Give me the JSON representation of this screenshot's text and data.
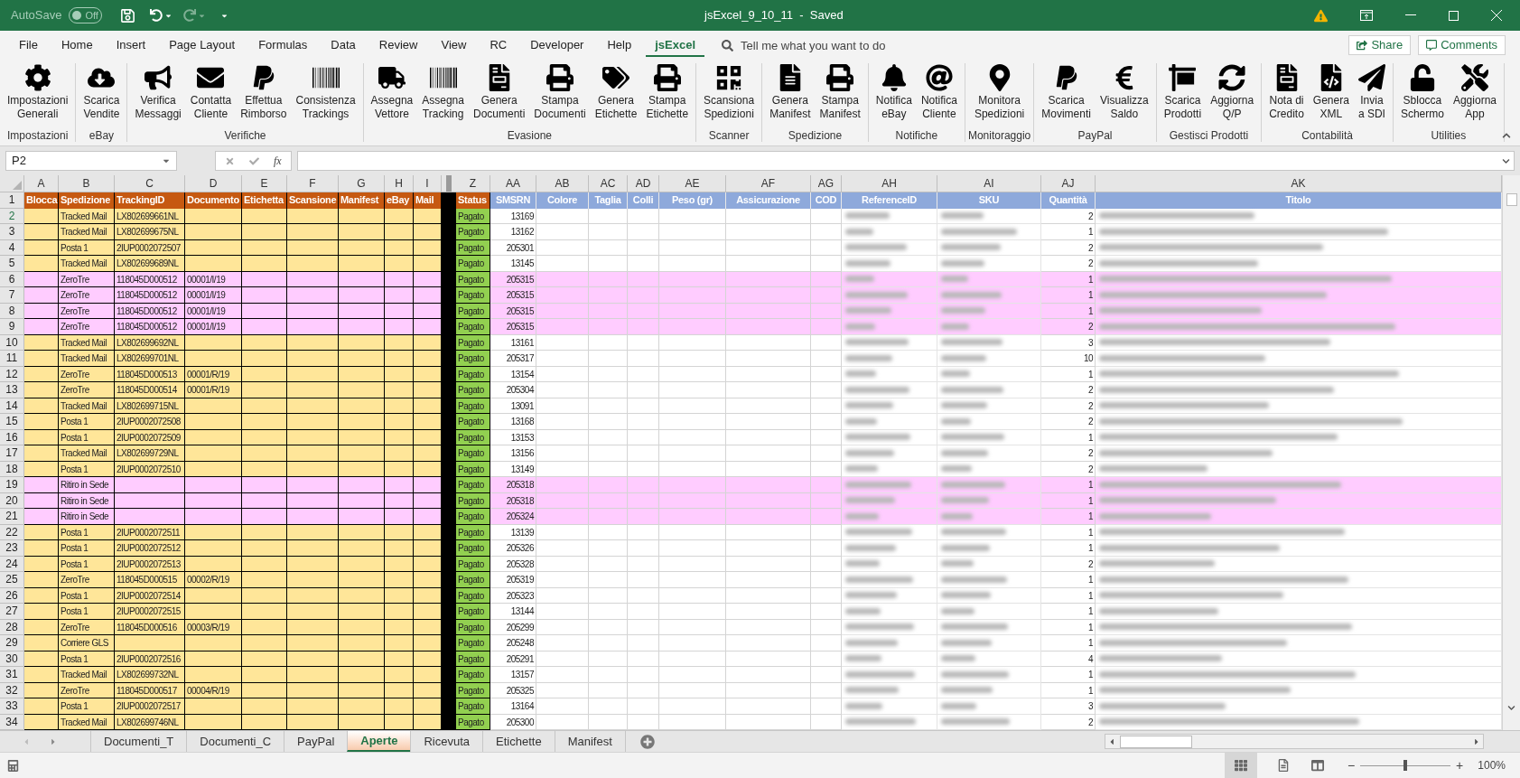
{
  "title_bar": {
    "autosave_label": "AutoSave",
    "autosave_toggle": {
      "label": "Off",
      "on": false
    },
    "title": "jsExcel_9_10_11  -  Saved"
  },
  "menu_tabs": [
    {
      "label": "File",
      "selected": false
    },
    {
      "label": "Home",
      "selected": false
    },
    {
      "label": "Insert",
      "selected": false
    },
    {
      "label": "Page Layout",
      "selected": false
    },
    {
      "label": "Formulas",
      "selected": false
    },
    {
      "label": "Data",
      "selected": false
    },
    {
      "label": "Review",
      "selected": false
    },
    {
      "label": "View",
      "selected": false
    },
    {
      "label": "RC",
      "selected": false
    },
    {
      "label": "Developer",
      "selected": false
    },
    {
      "label": "Help",
      "selected": false
    },
    {
      "label": "jsExcel",
      "selected": true
    }
  ],
  "tell_me": {
    "placeholder": "Tell me what you want to do"
  },
  "share_button": "Share",
  "comments_button": "Comments",
  "ribbon_groups": [
    {
      "label": "Impostazioni",
      "buttons": [
        {
          "lines": [
            "Impostazioni",
            "Generali"
          ]
        }
      ]
    },
    {
      "label": "eBay",
      "buttons": [
        {
          "lines": [
            "Scarica",
            "Vendite"
          ]
        }
      ]
    },
    {
      "label": "Verifiche",
      "buttons": [
        {
          "lines": [
            "Verifica",
            "Messaggi"
          ]
        },
        {
          "lines": [
            "Contatta",
            "Cliente"
          ]
        },
        {
          "lines": [
            "Effettua",
            "Rimborso"
          ]
        },
        {
          "lines": [
            "Consistenza",
            "Trackings"
          ]
        }
      ]
    },
    {
      "label": "Evasione",
      "buttons": [
        {
          "lines": [
            "Assegna",
            "Vettore"
          ]
        },
        {
          "lines": [
            "Assegna",
            "Tracking"
          ]
        },
        {
          "lines": [
            "Genera",
            "Documenti"
          ]
        },
        {
          "lines": [
            "Stampa",
            "Documenti"
          ]
        },
        {
          "lines": [
            "Genera",
            "Etichette"
          ]
        },
        {
          "lines": [
            "Stampa",
            "Etichette"
          ]
        }
      ]
    },
    {
      "label": "Scanner",
      "buttons": [
        {
          "lines": [
            "Scansiona",
            "Spedizioni"
          ]
        }
      ]
    },
    {
      "label": "Spedizione",
      "buttons": [
        {
          "lines": [
            "Genera",
            "Manifest"
          ]
        },
        {
          "lines": [
            "Stampa",
            "Manifest"
          ]
        }
      ]
    },
    {
      "label": "Notifiche",
      "buttons": [
        {
          "lines": [
            "Notifica",
            "eBay"
          ]
        },
        {
          "lines": [
            "Notifica",
            "Cliente"
          ]
        }
      ]
    },
    {
      "label": "Monitoraggio",
      "buttons": [
        {
          "lines": [
            "Monitora",
            "Spedizioni"
          ]
        }
      ]
    },
    {
      "label": "PayPal",
      "buttons": [
        {
          "lines": [
            "Scarica",
            "Movimenti"
          ]
        },
        {
          "lines": [
            "Visualizza",
            "Saldo"
          ]
        }
      ]
    },
    {
      "label": "Gestisci Prodotti",
      "buttons": [
        {
          "lines": [
            "Scarica",
            "Prodotti"
          ]
        },
        {
          "lines": [
            "Aggiorna",
            "Q/P"
          ]
        }
      ]
    },
    {
      "label": "Contabilità",
      "buttons": [
        {
          "lines": [
            "Nota di",
            "Credito"
          ]
        },
        {
          "lines": [
            "Genera",
            "XML"
          ]
        },
        {
          "lines": [
            "Invia",
            "a SDI"
          ]
        }
      ]
    },
    {
      "label": "Utilities",
      "buttons": [
        {
          "lines": [
            "Sblocca",
            "Schermo"
          ]
        },
        {
          "lines": [
            "Aggiorna",
            "App"
          ]
        }
      ]
    }
  ],
  "formula_bar": {
    "name_box": "P2",
    "fx": "fx"
  },
  "columns": [
    {
      "letter": "A",
      "header": "Blocca",
      "kind": "orange"
    },
    {
      "letter": "B",
      "header": "Spedizione",
      "kind": "orange"
    },
    {
      "letter": "C",
      "header": "TrackingID",
      "kind": "orange"
    },
    {
      "letter": "D",
      "header": "Documento",
      "kind": "orange"
    },
    {
      "letter": "E",
      "header": "Etichetta",
      "kind": "orange"
    },
    {
      "letter": "F",
      "header": "Scansione",
      "kind": "orange"
    },
    {
      "letter": "G",
      "header": "Manifest",
      "kind": "orange"
    },
    {
      "letter": "H",
      "header": "eBay",
      "kind": "orange"
    },
    {
      "letter": "I",
      "header": "Mail",
      "kind": "orange"
    },
    {
      "kind": "separator"
    },
    {
      "letter": "Z",
      "header": "Status",
      "kind": "orange"
    },
    {
      "letter": "AA",
      "header": "SMSRN",
      "kind": "blue"
    },
    {
      "letter": "AB",
      "header": "Colore",
      "kind": "blue"
    },
    {
      "letter": "AC",
      "header": "Taglia",
      "kind": "blue"
    },
    {
      "letter": "AD",
      "header": "Colli",
      "kind": "blue"
    },
    {
      "letter": "AE",
      "header": "Peso (gr)",
      "kind": "blue"
    },
    {
      "letter": "AF",
      "header": "Assicurazione",
      "kind": "blue"
    },
    {
      "letter": "AG",
      "header": "COD",
      "kind": "blue"
    },
    {
      "letter": "AH",
      "header": "ReferenceID",
      "kind": "blue"
    },
    {
      "letter": "AI",
      "header": "SKU",
      "kind": "blue"
    },
    {
      "letter": "AJ",
      "header": "Quantità",
      "kind": "blue"
    },
    {
      "letter": "AK",
      "header": "Titolo",
      "kind": "blue"
    }
  ],
  "header_row_number": "1",
  "rows": [
    {
      "num": "2",
      "spedizione": "Tracked Mail",
      "tracking": "LX802699661NL",
      "status": "Pagato",
      "smsrn": "13169",
      "quantita": "2",
      "highlighted": false
    },
    {
      "num": "3",
      "spedizione": "Tracked Mail",
      "tracking": "LX802699675NL",
      "status": "Pagato",
      "smsrn": "13162",
      "quantita": "1",
      "highlighted": false
    },
    {
      "num": "4",
      "spedizione": "Posta 1",
      "tracking": "2IUP0002072507",
      "status": "Pagato",
      "smsrn": "205301",
      "quantita": "2",
      "highlighted": false
    },
    {
      "num": "5",
      "spedizione": "Tracked Mail",
      "tracking": "LX802699689NL",
      "status": "Pagato",
      "smsrn": "13145",
      "quantita": "2",
      "highlighted": false
    },
    {
      "num": "6",
      "spedizione": "ZeroTre",
      "tracking": "118045D000512",
      "documento": "00001/I/19",
      "status": "Pagato",
      "smsrn": "205315",
      "quantita": "1",
      "highlighted": true
    },
    {
      "num": "7",
      "spedizione": "ZeroTre",
      "tracking": "118045D000512",
      "documento": "00001/I/19",
      "status": "Pagato",
      "smsrn": "205315",
      "quantita": "1",
      "highlighted": true
    },
    {
      "num": "8",
      "spedizione": "ZeroTre",
      "tracking": "118045D000512",
      "documento": "00001/I/19",
      "status": "Pagato",
      "smsrn": "205315",
      "quantita": "1",
      "highlighted": true
    },
    {
      "num": "9",
      "spedizione": "ZeroTre",
      "tracking": "118045D000512",
      "documento": "00001/I/19",
      "status": "Pagato",
      "smsrn": "205315",
      "quantita": "2",
      "highlighted": true
    },
    {
      "num": "10",
      "spedizione": "Tracked Mail",
      "tracking": "LX802699692NL",
      "status": "Pagato",
      "smsrn": "13161",
      "quantita": "3",
      "highlighted": false
    },
    {
      "num": "11",
      "spedizione": "Tracked Mail",
      "tracking": "LX802699701NL",
      "status": "Pagato",
      "smsrn": "205317",
      "quantita": "10",
      "highlighted": false
    },
    {
      "num": "12",
      "spedizione": "ZeroTre",
      "tracking": "118045D000513",
      "documento": "00001/R/19",
      "status": "Pagato",
      "smsrn": "13154",
      "quantita": "1",
      "highlighted": false
    },
    {
      "num": "13",
      "spedizione": "ZeroTre",
      "tracking": "118045D000514",
      "documento": "00001/R/19",
      "status": "Pagato",
      "smsrn": "205304",
      "quantita": "2",
      "highlighted": false
    },
    {
      "num": "14",
      "spedizione": "Tracked Mail",
      "tracking": "LX802699715NL",
      "status": "Pagato",
      "smsrn": "13091",
      "quantita": "2",
      "highlighted": false
    },
    {
      "num": "15",
      "spedizione": "Posta 1",
      "tracking": "2IUP0002072508",
      "status": "Pagato",
      "smsrn": "13168",
      "quantita": "2",
      "highlighted": false
    },
    {
      "num": "16",
      "spedizione": "Posta 1",
      "tracking": "2IUP0002072509",
      "status": "Pagato",
      "smsrn": "13153",
      "quantita": "1",
      "highlighted": false
    },
    {
      "num": "17",
      "spedizione": "Tracked Mail",
      "tracking": "LX802699729NL",
      "status": "Pagato",
      "smsrn": "13156",
      "quantita": "2",
      "highlighted": false
    },
    {
      "num": "18",
      "spedizione": "Posta 1",
      "tracking": "2IUP0002072510",
      "status": "Pagato",
      "smsrn": "13149",
      "quantita": "2",
      "highlighted": false
    },
    {
      "num": "19",
      "spedizione": "Ritiro in Sede",
      "status": "Pagato",
      "smsrn": "205318",
      "quantita": "1",
      "highlighted": true
    },
    {
      "num": "20",
      "spedizione": "Ritiro in Sede",
      "status": "Pagato",
      "smsrn": "205318",
      "quantita": "1",
      "highlighted": true
    },
    {
      "num": "21",
      "spedizione": "Ritiro in Sede",
      "status": "Pagato",
      "smsrn": "205324",
      "quantita": "1",
      "highlighted": true
    },
    {
      "num": "22",
      "spedizione": "Posta 1",
      "tracking": "2IUP0002072511",
      "status": "Pagato",
      "smsrn": "13139",
      "quantita": "1",
      "highlighted": false
    },
    {
      "num": "23",
      "spedizione": "Posta 1",
      "tracking": "2IUP0002072512",
      "status": "Pagato",
      "smsrn": "205326",
      "quantita": "1",
      "highlighted": false
    },
    {
      "num": "24",
      "spedizione": "Posta 1",
      "tracking": "2IUP0002072513",
      "status": "Pagato",
      "smsrn": "205328",
      "quantita": "2",
      "highlighted": false
    },
    {
      "num": "25",
      "spedizione": "ZeroTre",
      "tracking": "118045D000515",
      "documento": "00002/R/19",
      "status": "Pagato",
      "smsrn": "205319",
      "quantita": "1",
      "highlighted": false
    },
    {
      "num": "26",
      "spedizione": "Posta 1",
      "tracking": "2IUP0002072514",
      "status": "Pagato",
      "smsrn": "205323",
      "quantita": "1",
      "highlighted": false
    },
    {
      "num": "27",
      "spedizione": "Posta 1",
      "tracking": "2IUP0002072515",
      "status": "Pagato",
      "smsrn": "13144",
      "quantita": "1",
      "highlighted": false
    },
    {
      "num": "28",
      "spedizione": "ZeroTre",
      "tracking": "118045D000516",
      "documento": "00003/R/19",
      "status": "Pagato",
      "smsrn": "205299",
      "quantita": "1",
      "highlighted": false
    },
    {
      "num": "29",
      "spedizione": "Corriere GLS",
      "status": "Pagato",
      "smsrn": "205248",
      "quantita": "1",
      "highlighted": false
    },
    {
      "num": "30",
      "spedizione": "Posta 1",
      "tracking": "2IUP0002072516",
      "status": "Pagato",
      "smsrn": "205291",
      "quantita": "4",
      "highlighted": false
    },
    {
      "num": "31",
      "spedizione": "Tracked Mail",
      "tracking": "LX802699732NL",
      "status": "Pagato",
      "smsrn": "13157",
      "quantita": "1",
      "highlighted": false
    },
    {
      "num": "32",
      "spedizione": "ZeroTre",
      "tracking": "118045D000517",
      "documento": "00004/R/19",
      "status": "Pagato",
      "smsrn": "205325",
      "quantita": "1",
      "highlighted": false
    },
    {
      "num": "33",
      "spedizione": "Posta 1",
      "tracking": "2IUP0002072517",
      "status": "Pagato",
      "smsrn": "13164",
      "quantita": "3",
      "highlighted": false
    },
    {
      "num": "34",
      "spedizione": "Tracked Mail",
      "tracking": "LX802699746NL",
      "status": "Pagato",
      "smsrn": "205300",
      "quantita": "2",
      "highlighted": false
    }
  ],
  "sheet_tabs": [
    {
      "label": "Documenti_T",
      "selected": false
    },
    {
      "label": "Documenti_C",
      "selected": false
    },
    {
      "label": "PayPal",
      "selected": false
    },
    {
      "label": "Aperte",
      "selected": true
    },
    {
      "label": "Ricevuta",
      "selected": false
    },
    {
      "label": "Etichette",
      "selected": false
    },
    {
      "label": "Manifest",
      "selected": false
    }
  ],
  "status_bar": {
    "zoom_out": "−",
    "zoom_slider": {
      "level": 0.5
    },
    "zoom_in": "+",
    "zoom": "100%"
  }
}
